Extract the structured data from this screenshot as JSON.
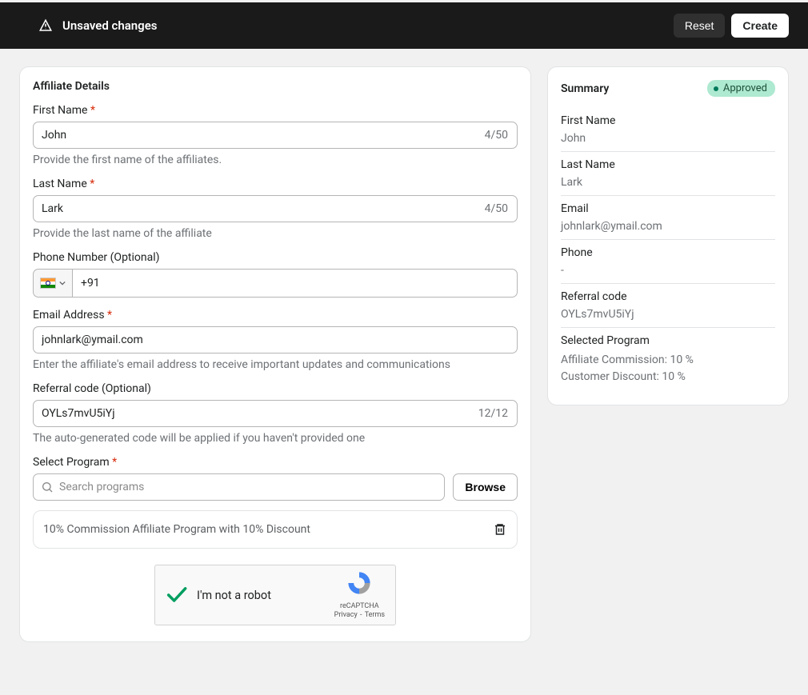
{
  "topbar": {
    "unsaved_text": "Unsaved changes",
    "reset_label": "Reset",
    "create_label": "Create"
  },
  "form": {
    "title": "Affiliate Details",
    "first_name": {
      "label": "First Name",
      "value": "John",
      "count": "4/50",
      "help": "Provide the first name of the affiliates."
    },
    "last_name": {
      "label": "Last Name",
      "value": "Lark",
      "count": "4/50",
      "help": "Provide the last name of the affiliate"
    },
    "phone": {
      "label": "Phone Number (Optional)",
      "value": "+91"
    },
    "email": {
      "label": "Email Address",
      "value": "johnlark@ymail.com",
      "help": "Enter the affiliate's email address to receive important updates and communications"
    },
    "referral": {
      "label": "Referral code (Optional)",
      "value": "OYLs7mvU5iYj",
      "count": "12/12",
      "help": "The auto-generated code will be applied if you haven't provided one"
    },
    "program": {
      "label": "Select Program",
      "placeholder": "Search programs",
      "browse_label": "Browse",
      "selected": "10% Commission Affiliate Program with 10% Discount"
    },
    "captcha": {
      "label": "I'm not a robot",
      "brand": "reCAPTCHA",
      "privacy": "Privacy",
      "terms": "Terms"
    }
  },
  "summary": {
    "title": "Summary",
    "status": "Approved",
    "first_name_label": "First Name",
    "first_name_value": "John",
    "last_name_label": "Last Name",
    "last_name_value": "Lark",
    "email_label": "Email",
    "email_value": "johnlark@ymail.com",
    "phone_label": "Phone",
    "phone_value": "-",
    "referral_label": "Referral code",
    "referral_value": "OYLs7mvU5iYj",
    "program_label": "Selected Program",
    "program_value_1": "Affiliate Commission: 10 %",
    "program_value_2": "Customer Discount: 10 %"
  }
}
